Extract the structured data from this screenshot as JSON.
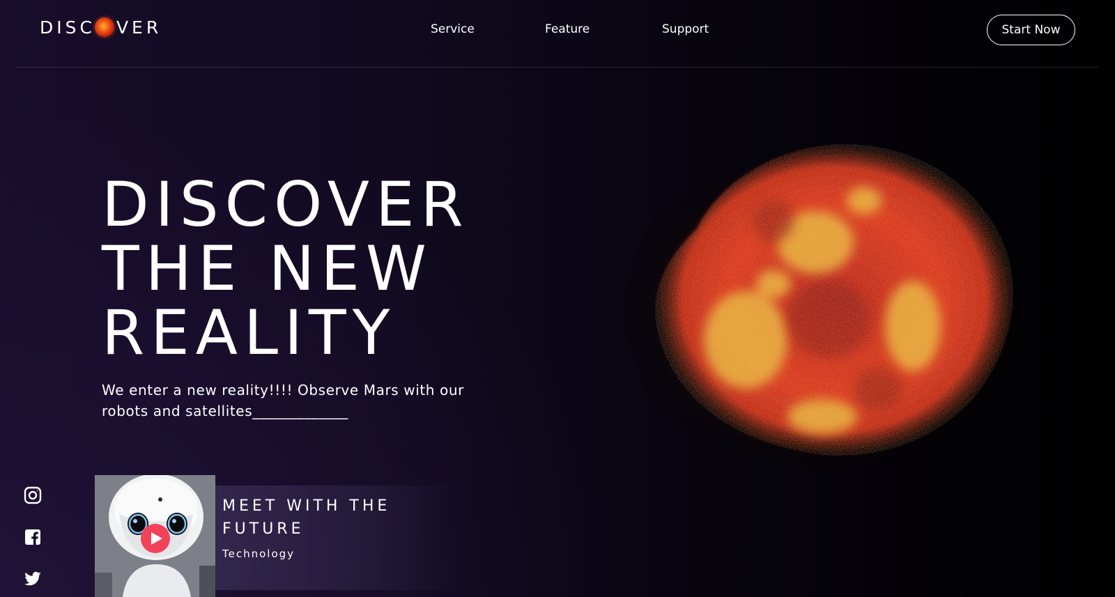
{
  "header": {
    "logo": {
      "text_before": "DISC",
      "text_after": "VER",
      "planet_icon": "planet-icon"
    },
    "nav": [
      {
        "label": "Service"
      },
      {
        "label": "Feature"
      },
      {
        "label": "Support"
      }
    ],
    "cta_label": "Start Now"
  },
  "hero": {
    "title_lines": [
      "DISCOVER",
      "THE NEW",
      "REALITY"
    ],
    "subtitle": "We enter a new reality!!!! Observe Mars with our robots and satellites_____________"
  },
  "social": [
    {
      "icon": "instagram-icon"
    },
    {
      "icon": "facebook-icon"
    },
    {
      "icon": "twitter-icon"
    }
  ],
  "card": {
    "title": "MEET WITH THE FUTURE",
    "tag": "Technology",
    "thumbnail_icon": "robot-image",
    "play_icon": "play-icon"
  },
  "colors": {
    "accent_play": "#f1425a",
    "planet_red": "#d9361f",
    "planet_yellow": "#e8b23e",
    "background_purple": "#170d2b"
  }
}
